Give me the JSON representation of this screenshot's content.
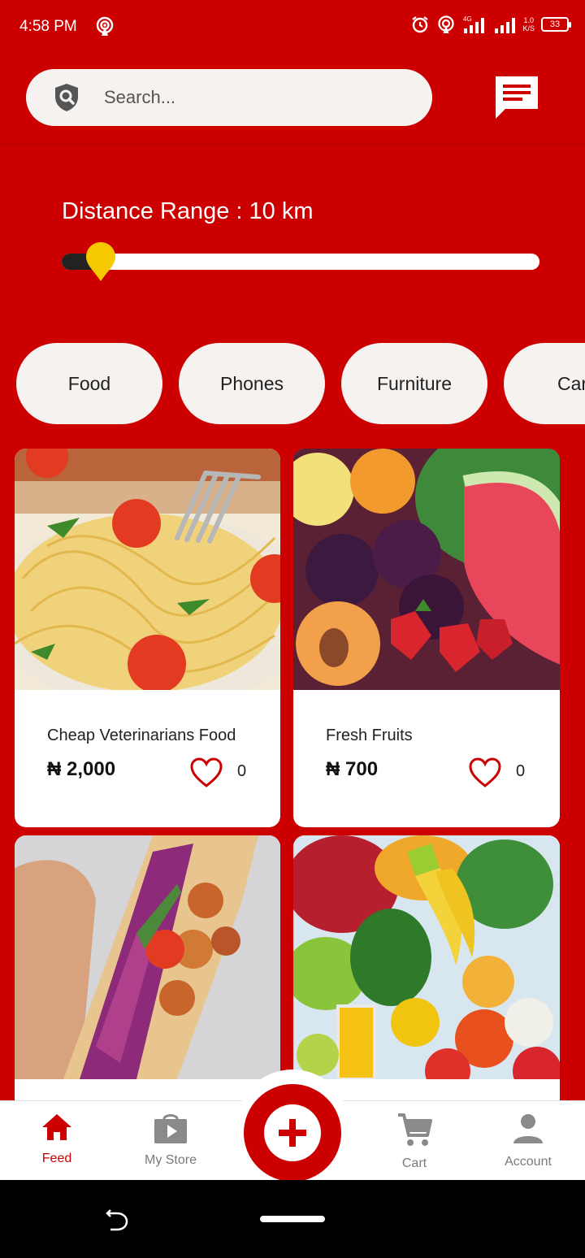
{
  "status_bar": {
    "time": "4:58 PM",
    "battery": "33",
    "net_speed_value": "1.0",
    "net_speed_unit": "K/S",
    "network_type": "4G"
  },
  "search": {
    "placeholder": "Search..."
  },
  "distance": {
    "label": "Distance Range : 10 km",
    "fraction": 0.08
  },
  "categories": [
    "Food",
    "Phones",
    "Furniture",
    "Cars"
  ],
  "products": [
    {
      "title": "Cheap Veterinarians Food",
      "price": "₦ 2,000",
      "likes": "0"
    },
    {
      "title": "Fresh Fruits",
      "price": "₦ 700",
      "likes": "0"
    },
    {
      "title": "",
      "price": "",
      "likes": ""
    },
    {
      "title": "",
      "price": "",
      "likes": ""
    }
  ],
  "nav": {
    "feed": "Feed",
    "my_store": "My Store",
    "cart": "Cart",
    "account": "Account"
  },
  "colors": {
    "brand": "#cc0000",
    "accent": "#f5c800",
    "chip_bg": "#f5f2f0"
  }
}
